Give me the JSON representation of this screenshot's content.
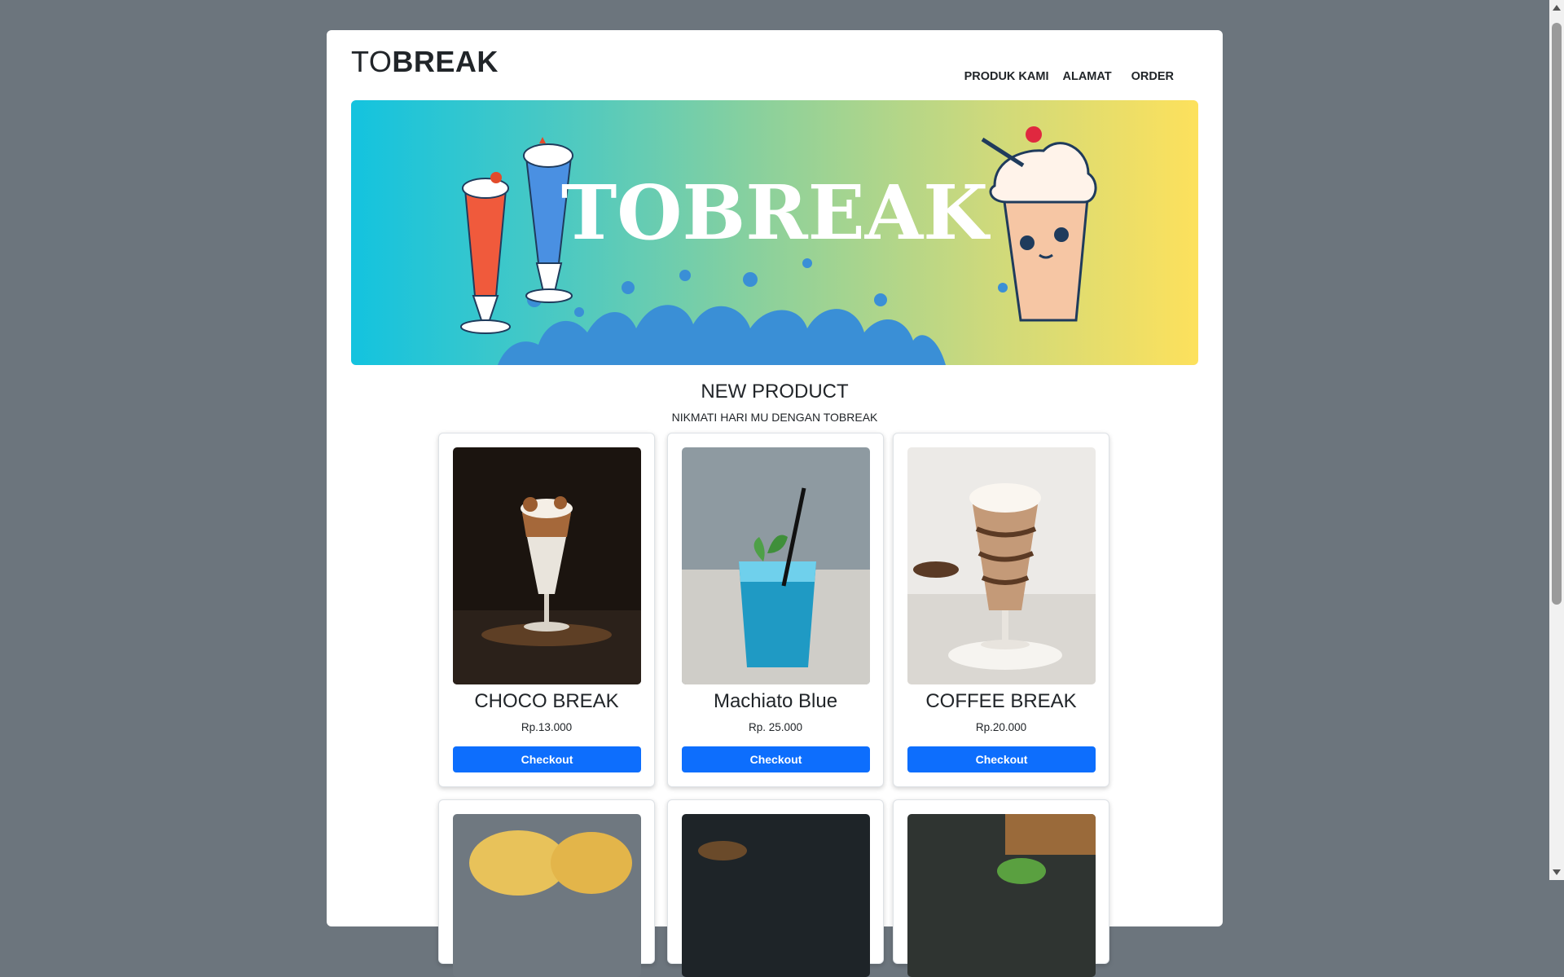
{
  "brand": {
    "light": "TO",
    "bold": "BREAK"
  },
  "nav": {
    "items": [
      "PRODUK KAMI",
      "ALAMAT",
      "ORDER"
    ]
  },
  "hero": {
    "title": "TOBREAK"
  },
  "section": {
    "title": "NEW PRODUCT",
    "subtitle": "NIKMATI HARI MU DENGAN TOBREAK"
  },
  "products": [
    {
      "name": "CHOCO BREAK",
      "price": "Rp.13.000",
      "button": "Checkout"
    },
    {
      "name": "Machiato Blue",
      "price": "Rp. 25.000",
      "button": "Checkout"
    },
    {
      "name": "COFFEE BREAK",
      "price": "Rp.20.000",
      "button": "Checkout"
    }
  ],
  "colors": {
    "background": "#6c757d",
    "primary": "#0d6efd",
    "text": "#212529"
  }
}
